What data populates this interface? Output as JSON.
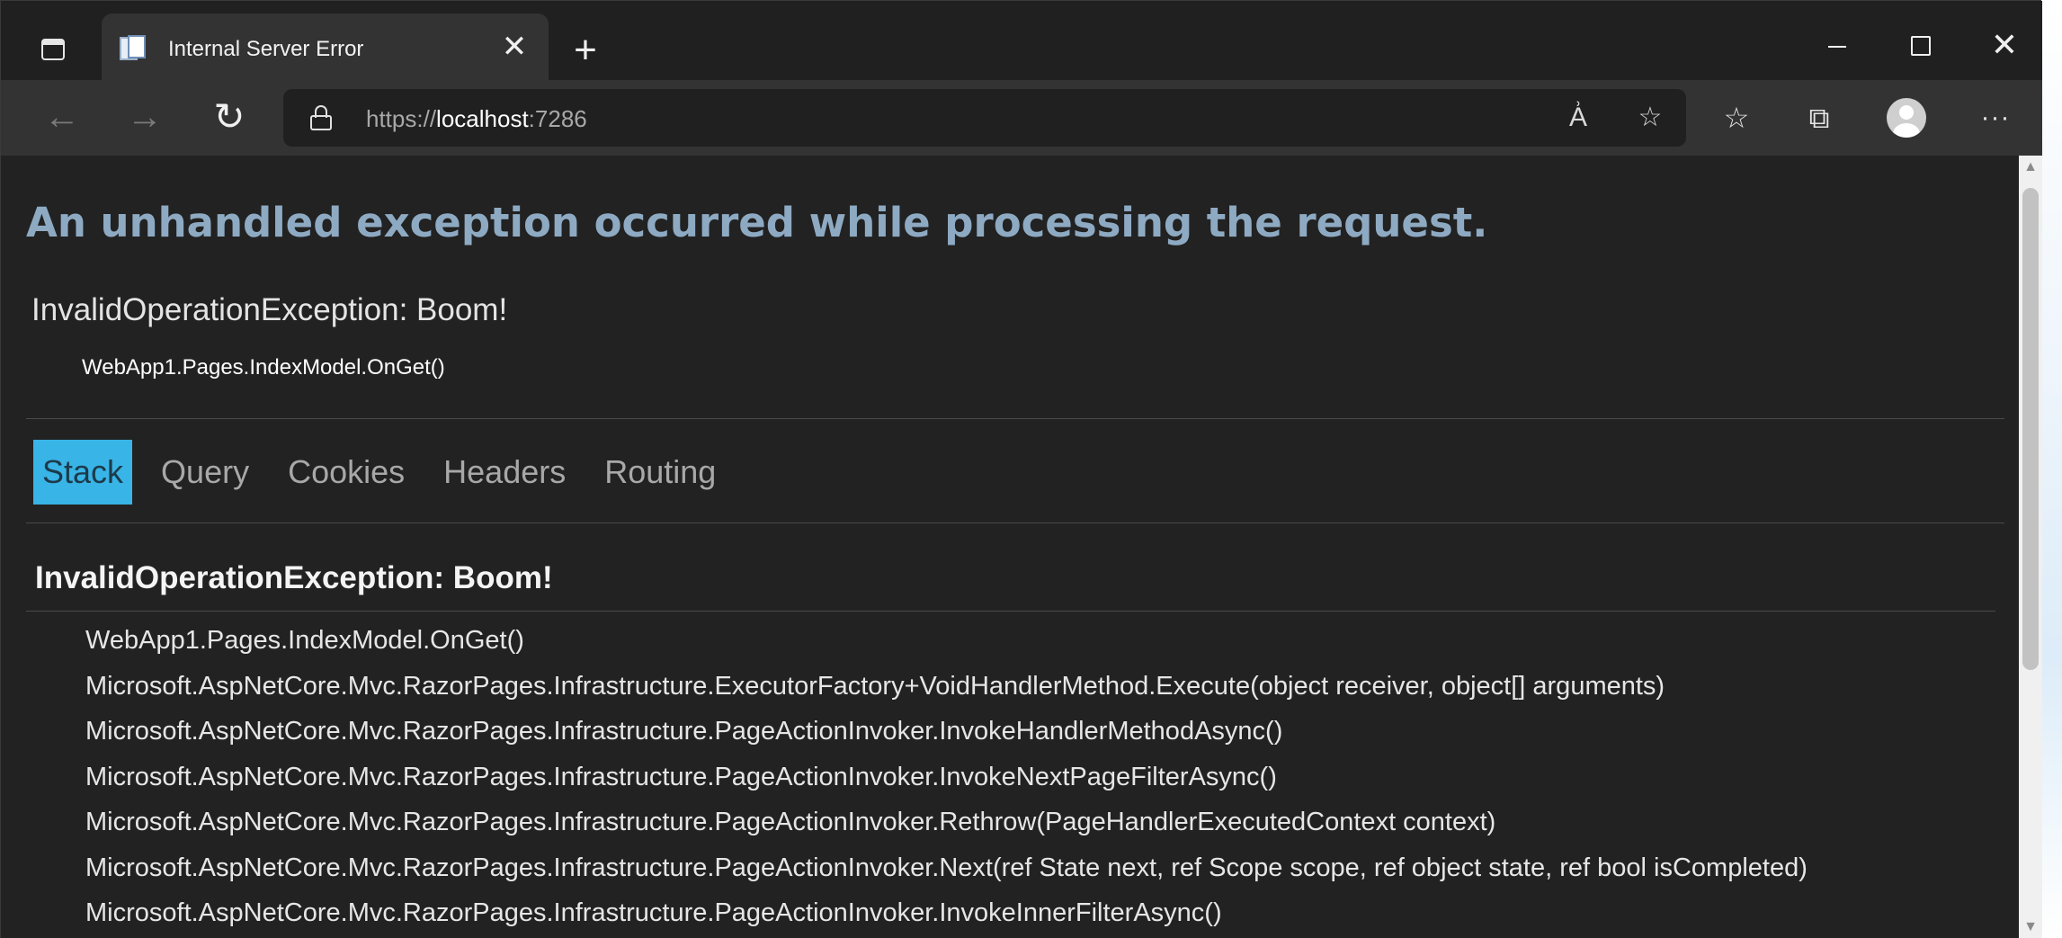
{
  "browser": {
    "tab": {
      "title": "Internal Server Error",
      "close_glyph": "✕"
    },
    "new_tab_glyph": "+",
    "window_controls": {
      "close_glyph": "✕"
    },
    "nav": {
      "back_glyph": "←",
      "forward_glyph": "→",
      "refresh_glyph": "↻"
    },
    "address": {
      "scheme": "https://",
      "host": "localhost",
      "port": ":7286"
    },
    "icons": {
      "read_aloud": "read-aloud-icon",
      "add_favorite": "add-favorite-icon",
      "favorites": "favorites-icon",
      "collections": "collections-icon",
      "profile": "profile-icon",
      "more": "more-icon"
    },
    "icon_glyphs": {
      "read_aloud": "A͗",
      "add_favorite": "☆",
      "favorites": "☆",
      "collections": "⧉",
      "more": "···"
    }
  },
  "page": {
    "title": "An unhandled exception occurred while processing the request.",
    "exception_summary": "InvalidOperationException: Boom!",
    "exception_location": "WebApp1.Pages.IndexModel.OnGet()",
    "tabs": [
      {
        "label": "Stack",
        "active": true
      },
      {
        "label": "Query",
        "active": false
      },
      {
        "label": "Cookies",
        "active": false
      },
      {
        "label": "Headers",
        "active": false
      },
      {
        "label": "Routing",
        "active": false
      }
    ],
    "stack": {
      "heading": "InvalidOperationException: Boom!",
      "frames": [
        "WebApp1.Pages.IndexModel.OnGet()",
        "Microsoft.AspNetCore.Mvc.RazorPages.Infrastructure.ExecutorFactory+VoidHandlerMethod.Execute(object receiver, object[] arguments)",
        "Microsoft.AspNetCore.Mvc.RazorPages.Infrastructure.PageActionInvoker.InvokeHandlerMethodAsync()",
        "Microsoft.AspNetCore.Mvc.RazorPages.Infrastructure.PageActionInvoker.InvokeNextPageFilterAsync()",
        "Microsoft.AspNetCore.Mvc.RazorPages.Infrastructure.PageActionInvoker.Rethrow(PageHandlerExecutedContext context)",
        "Microsoft.AspNetCore.Mvc.RazorPages.Infrastructure.PageActionInvoker.Next(ref State next, ref Scope scope, ref object state, ref bool isCompleted)",
        "Microsoft.AspNetCore.Mvc.RazorPages.Infrastructure.PageActionInvoker.InvokeInnerFilterAsync()"
      ]
    }
  },
  "colors": {
    "title": "#8eaac3",
    "active_tab_bg": "#38b4e6",
    "content_bg": "#222222",
    "chrome_bg": "#202020",
    "toolbar_bg": "#333333"
  }
}
